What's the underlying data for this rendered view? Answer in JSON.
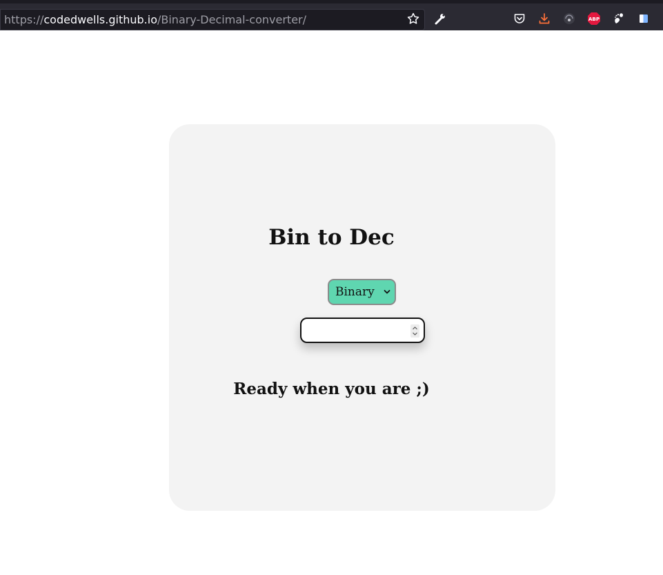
{
  "browser": {
    "url_scheme": "https://",
    "url_host": "codedwells.github.io",
    "url_path": "/Binary-Decimal-converter/",
    "icons": [
      "bookmark-star-icon",
      "wrench-icon",
      "pocket-icon",
      "download-icon",
      "extension-dark-icon",
      "adblock-plus-icon",
      "gnome-icon",
      "sidebar-icon"
    ],
    "colors": {
      "chrome": "#2b2a33",
      "urlbar": "#1c1b22",
      "download": "#ff7139",
      "abp": "#e3193f"
    }
  },
  "page": {
    "title": "Bin to Dec",
    "mode_select": {
      "selected": "Binary"
    },
    "number_input": {
      "value": ""
    },
    "status": "Ready when you are ;)",
    "colors": {
      "card": "#f3f3f3",
      "select": "#5fd6b0"
    }
  }
}
